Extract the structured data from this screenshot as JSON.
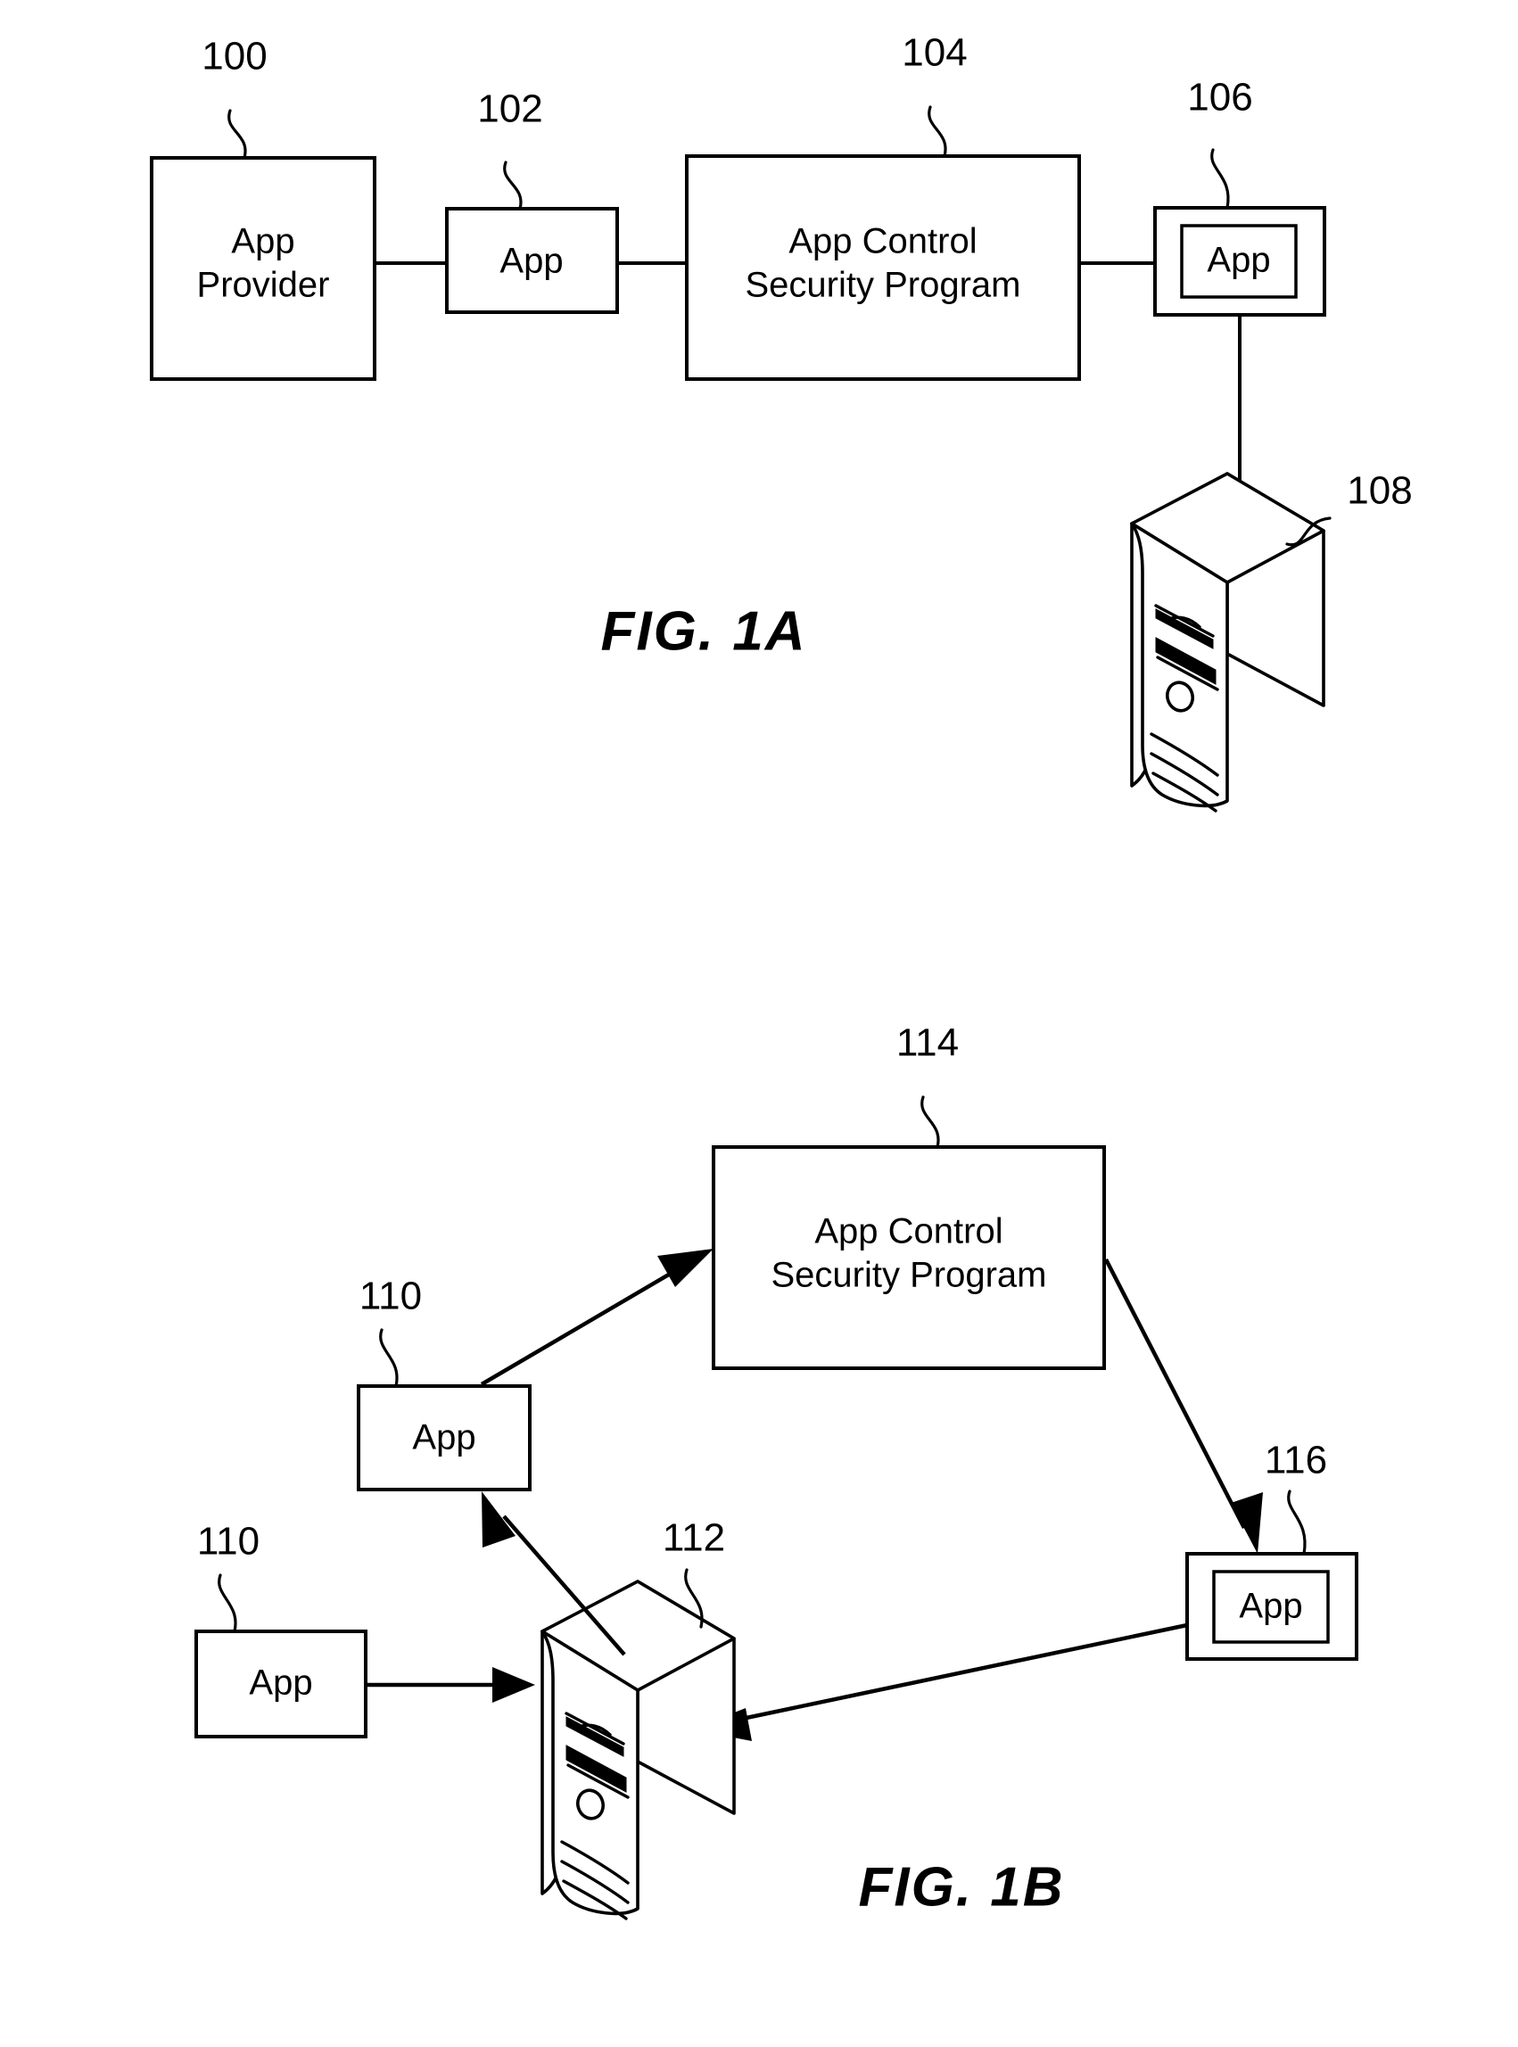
{
  "document": {
    "type": "patent-figure-sheet",
    "sheet_background": "#ffffff",
    "ink_color": "#000000"
  },
  "figures": [
    {
      "id": "fig-1a",
      "caption": "FIG. 1A",
      "nodes": [
        {
          "ref": "100",
          "label": "App Provider",
          "shape": "rect"
        },
        {
          "ref": "102",
          "label": "App",
          "shape": "rect"
        },
        {
          "ref": "104",
          "label": "App Control Security Program",
          "shape": "rect"
        },
        {
          "ref": "106",
          "label": "App",
          "shape": "double-rect"
        },
        {
          "ref": "108",
          "label": "",
          "shape": "computer-tower"
        }
      ],
      "edges": [
        {
          "from": "100",
          "to": "102",
          "style": "plain-line"
        },
        {
          "from": "102",
          "to": "104",
          "style": "plain-line"
        },
        {
          "from": "104",
          "to": "106",
          "style": "plain-line"
        },
        {
          "from": "106",
          "to": "108",
          "style": "plain-line"
        }
      ]
    },
    {
      "id": "fig-1b",
      "caption": "FIG. 1B",
      "nodes": [
        {
          "ref": "114",
          "label": "App Control Security Program",
          "shape": "rect"
        },
        {
          "ref": "110",
          "label": "App",
          "shape": "rect",
          "position": "upper-left"
        },
        {
          "ref": "110",
          "label": "App",
          "shape": "rect",
          "position": "lower-left"
        },
        {
          "ref": "112",
          "label": "",
          "shape": "computer-tower"
        },
        {
          "ref": "116",
          "label": "App",
          "shape": "double-rect"
        }
      ],
      "edges": [
        {
          "from": "110-upper",
          "to": "114",
          "style": "arrow"
        },
        {
          "from": "114",
          "to": "116",
          "style": "arrow"
        },
        {
          "from": "116",
          "to": "112",
          "style": "arrow"
        },
        {
          "from": "112",
          "to": "110-upper",
          "style": "arrow"
        },
        {
          "from": "110-lower",
          "to": "112",
          "style": "arrow"
        }
      ]
    }
  ],
  "fig1a": {
    "caption": "FIG. 1A",
    "app_provider": {
      "ref": "100",
      "line1": "App",
      "line2": "Provider"
    },
    "app": {
      "ref": "102",
      "label": "App"
    },
    "security_program": {
      "ref": "104",
      "line1": "App Control",
      "line2": "Security Program"
    },
    "app_boxed": {
      "ref": "106",
      "label": "App"
    },
    "computer": {
      "ref": "108",
      "name": "computer-tower"
    }
  },
  "fig1b": {
    "caption": "FIG. 1B",
    "security_program": {
      "ref": "114",
      "line1": "App Control",
      "line2": "Security Program"
    },
    "app_upper": {
      "ref": "110",
      "label": "App"
    },
    "app_lower": {
      "ref": "110",
      "label": "App"
    },
    "computer": {
      "ref": "112",
      "name": "computer-tower"
    },
    "app_boxed": {
      "ref": "116",
      "label": "App"
    }
  }
}
